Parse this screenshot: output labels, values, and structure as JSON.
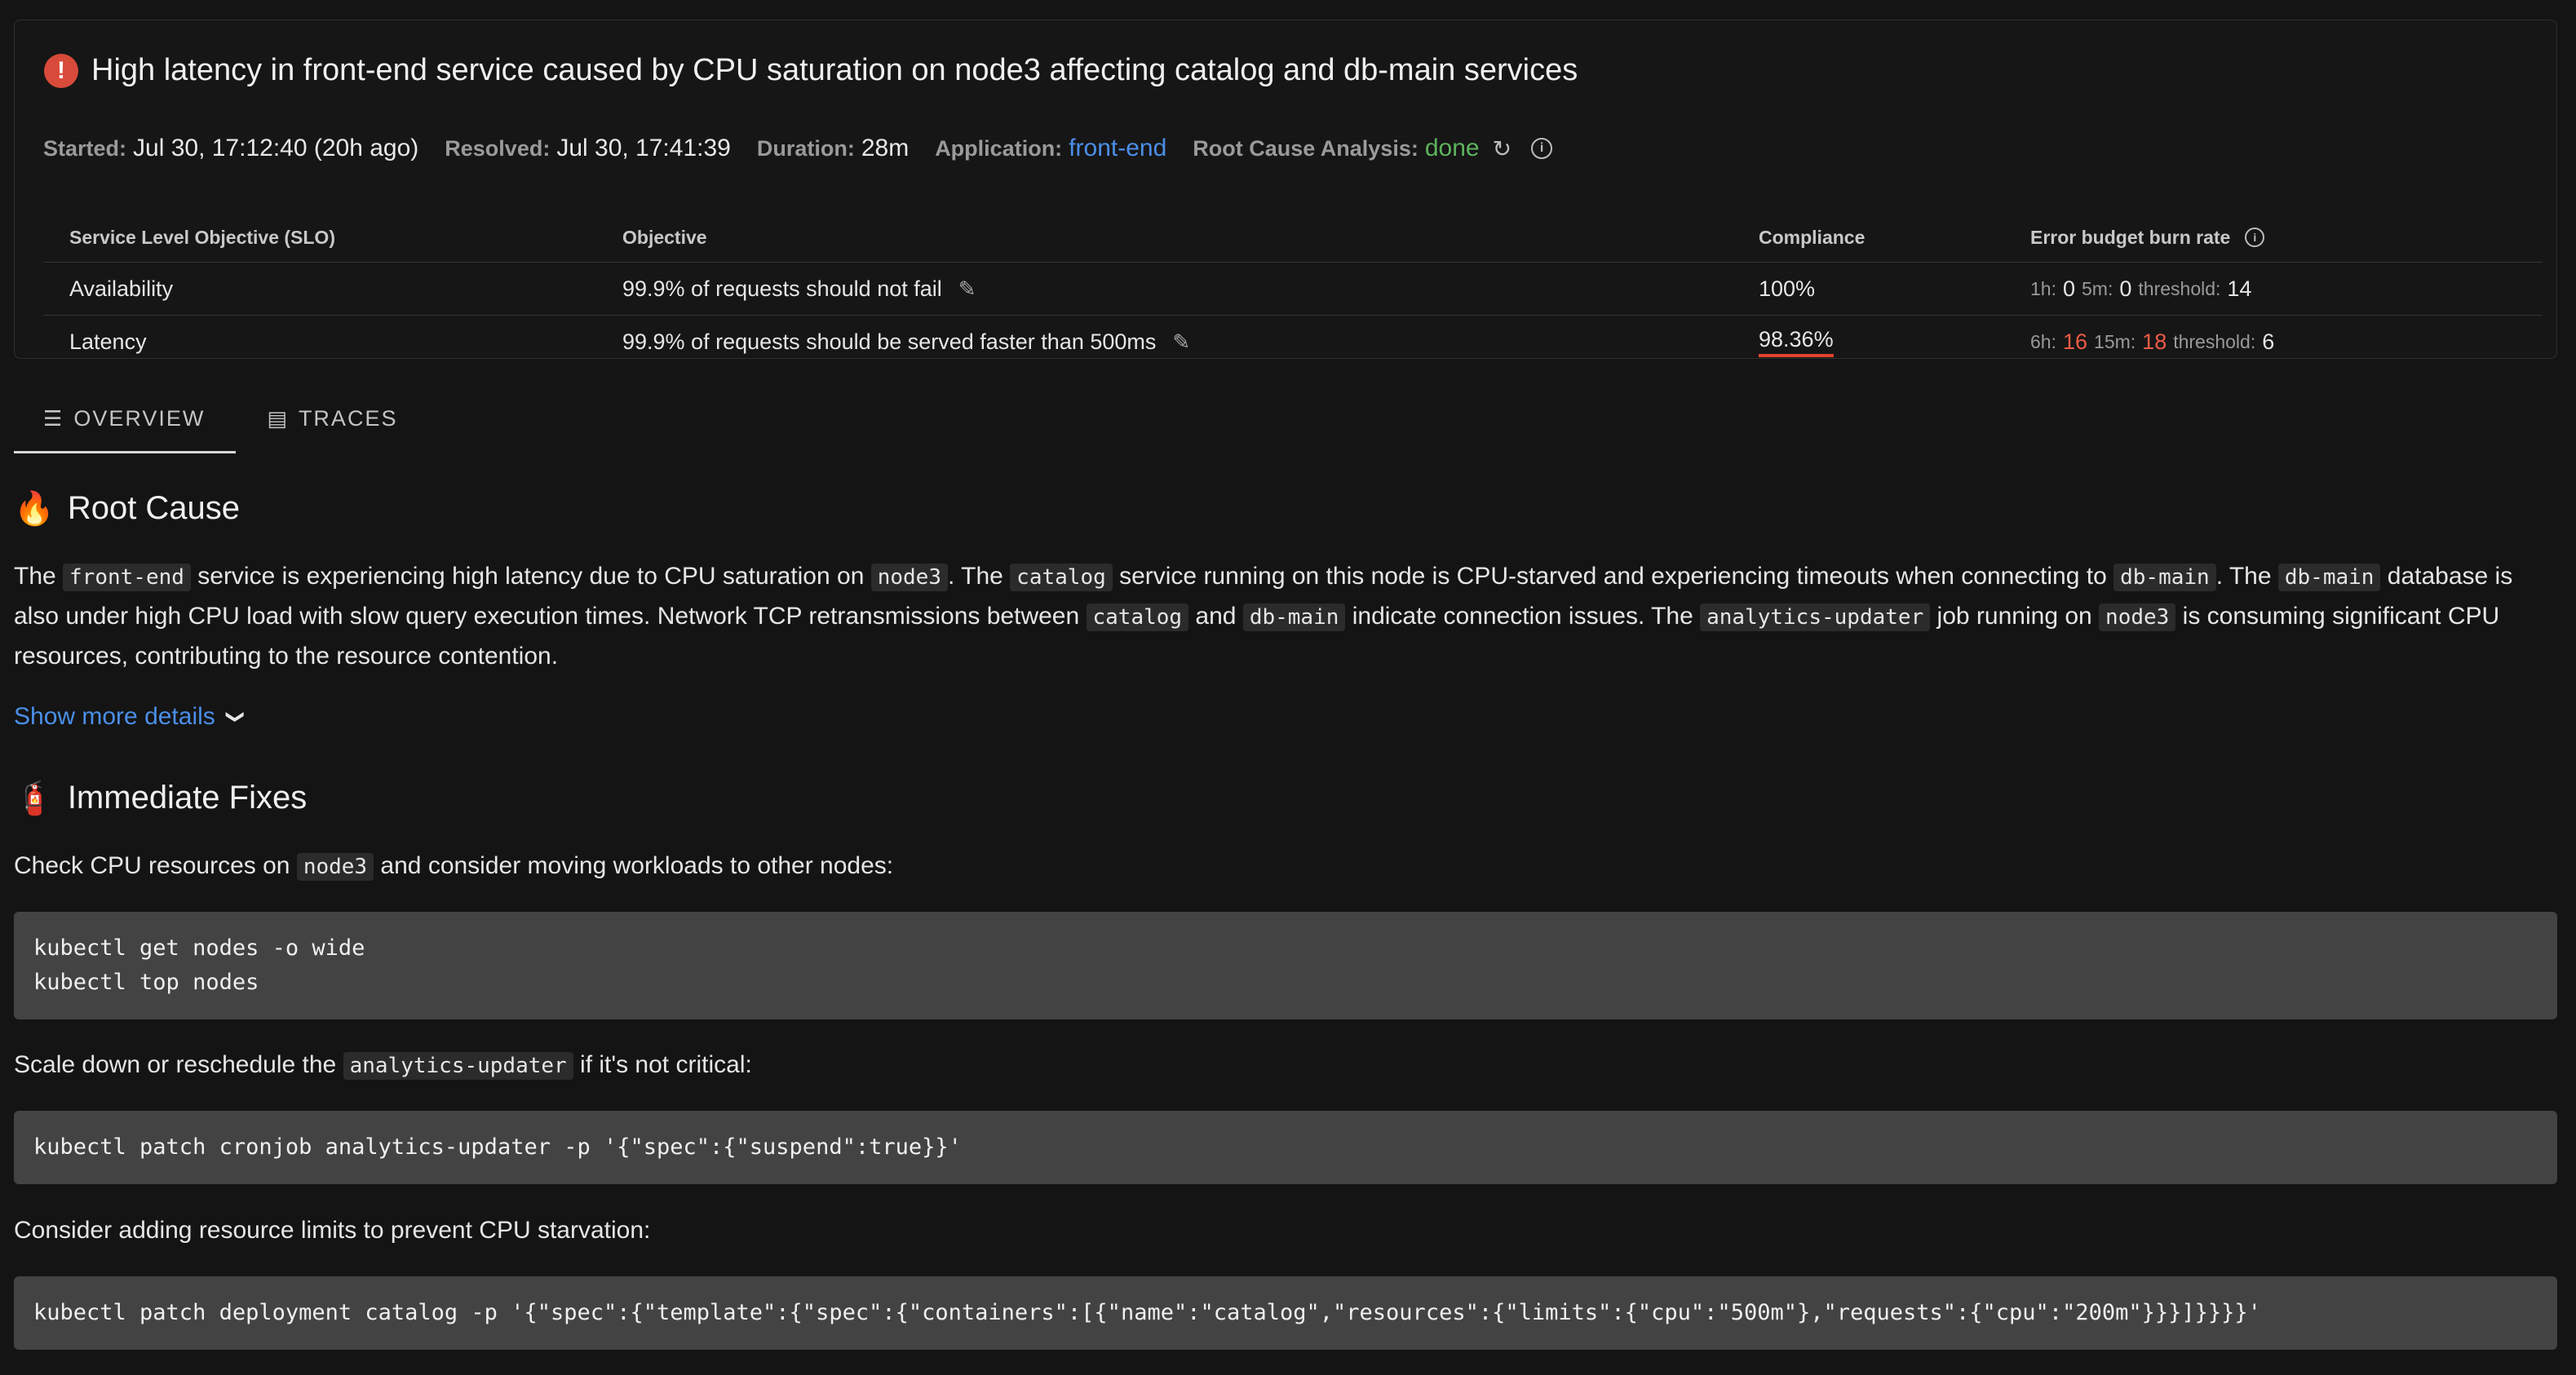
{
  "incident": {
    "title": "High latency in front-end service caused by CPU saturation on node3 affecting catalog and db-main services",
    "started_label": "Started:",
    "started_value": "Jul 30, 17:12:40 (20h ago)",
    "resolved_label": "Resolved:",
    "resolved_value": "Jul 30, 17:41:39",
    "duration_label": "Duration:",
    "duration_value": "28m",
    "application_label": "Application:",
    "application_value": "front-end",
    "rca_label": "Root Cause Analysis:",
    "rca_value": "done"
  },
  "slo_table": {
    "headers": [
      "Service Level Objective (SLO)",
      "Objective",
      "Compliance",
      "Error budget burn rate"
    ],
    "rows": [
      {
        "name": "Availability",
        "objective": "99.9% of requests should not fail",
        "compliance": "100%",
        "burn": {
          "w1_label": "1h:",
          "w1_value": "0",
          "w2_label": "5m:",
          "w2_value": "0",
          "threshold_label": "threshold:",
          "threshold_value": "14"
        }
      },
      {
        "name": "Latency",
        "objective": "99.9% of requests should be served faster than 500ms",
        "compliance": "98.36%",
        "burn": {
          "w1_label": "6h:",
          "w1_value": "16",
          "w2_label": "15m:",
          "w2_value": "18",
          "threshold_label": "threshold:",
          "threshold_value": "6"
        }
      }
    ]
  },
  "tabs": [
    {
      "label": "OVERVIEW",
      "icon": "list-icon",
      "active": true
    },
    {
      "label": "TRACES",
      "icon": "traces-icon",
      "active": false
    }
  ],
  "root_cause": {
    "title": "Root Cause",
    "p1": "The ",
    "c1": "front-end",
    "p2": " service is experiencing high latency due to CPU saturation on ",
    "c2": "node3",
    "p3": ". The ",
    "c3": "catalog",
    "p4": " service running on this node is CPU-starved and experiencing timeouts when connecting to ",
    "c4": "db-main",
    "p5": ". The ",
    "c5": "db-main",
    "p6": " database is also under high CPU load with slow query execution times. Network TCP retransmissions between ",
    "c6": "catalog",
    "p7": " and ",
    "c7": "db-main",
    "p8": " indicate connection issues. The ",
    "c8": "analytics-updater",
    "p9": " job running on ",
    "c9": "node3",
    "p10": " is consuming significant CPU resources, contributing to the resource contention.",
    "show_more": "Show more details"
  },
  "fixes": {
    "title": "Immediate Fixes",
    "s1_a": "Check CPU resources on ",
    "s1_code": "node3",
    "s1_b": " and consider moving workloads to other nodes:",
    "cmd1": "kubectl get nodes -o wide\nkubectl top nodes",
    "s2_a": "Scale down or reschedule the ",
    "s2_code": "analytics-updater",
    "s2_b": " if it's not critical:",
    "cmd2": "kubectl patch cronjob analytics-updater -p '{\"spec\":{\"suspend\":true}}'",
    "s3": "Consider adding resource limits to prevent CPU starvation:",
    "cmd3": "kubectl patch deployment catalog -p '{\"spec\":{\"template\":{\"spec\":{\"containers\":[{\"name\":\"catalog\",\"resources\":{\"limits\":{\"cpu\":\"500m\"},\"requests\":{\"cpu\":\"200m\"}}}]}}}}'"
  },
  "colors": {
    "accent_link": "#4b8fe8",
    "done": "#5db35d",
    "alert": "#d84a3a",
    "burn_red": "#ef5b47"
  }
}
